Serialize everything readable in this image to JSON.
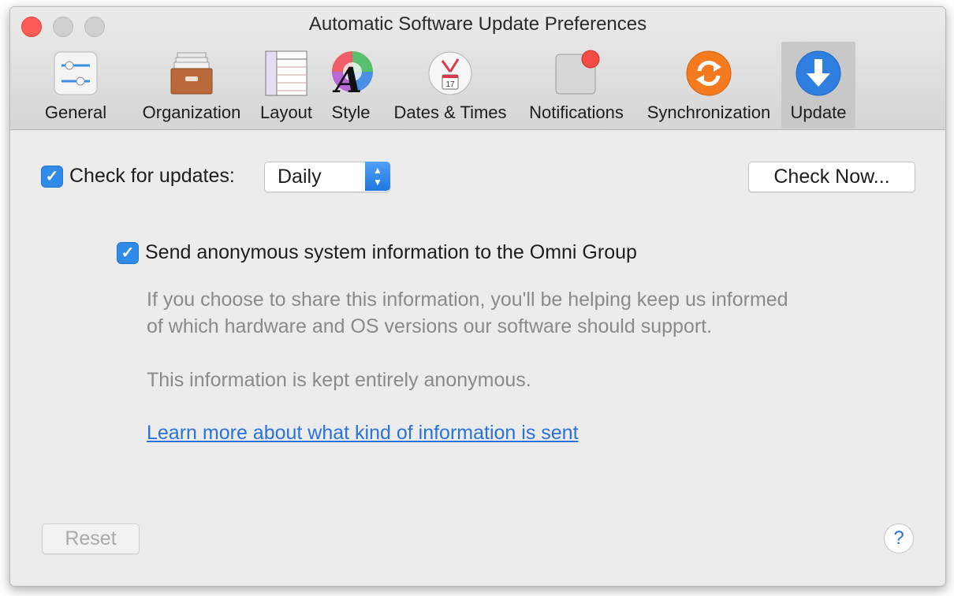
{
  "window": {
    "title": "Automatic Software Update Preferences"
  },
  "toolbar": {
    "items": [
      {
        "label": "General",
        "icon": "sliders-icon"
      },
      {
        "label": "Organization",
        "icon": "drawer-icon"
      },
      {
        "label": "Layout",
        "icon": "layout-columns-icon"
      },
      {
        "label": "Style",
        "icon": "style-color-wheel-icon"
      },
      {
        "label": "Dates & Times",
        "icon": "calendar-clock-icon"
      },
      {
        "label": "Notifications",
        "icon": "notification-badge-icon"
      },
      {
        "label": "Synchronization",
        "icon": "sync-icon"
      },
      {
        "label": "Update",
        "icon": "download-arrow-icon",
        "selected": true
      }
    ]
  },
  "update": {
    "check_label": "Check for updates:",
    "check_checked": true,
    "frequency_value": "Daily",
    "check_now_label": "Check Now...",
    "anon_label": "Send anonymous system information to the Omni Group",
    "anon_checked": true,
    "info_line1": "If you choose to share this information, you'll be helping keep us informed",
    "info_line2": "of which hardware and OS versions our software should support.",
    "info_anon": "This information is kept entirely anonymous.",
    "learn_more_link": "Learn more about what kind of information is sent",
    "reset_label": "Reset",
    "help_label": "?",
    "calendar_day": "17"
  },
  "colors": {
    "accent": "#2f8ae8",
    "link": "#2a72d8",
    "close": "#fc5b57",
    "sync_orange": "#f47a20",
    "update_blue": "#2e7fe0"
  }
}
